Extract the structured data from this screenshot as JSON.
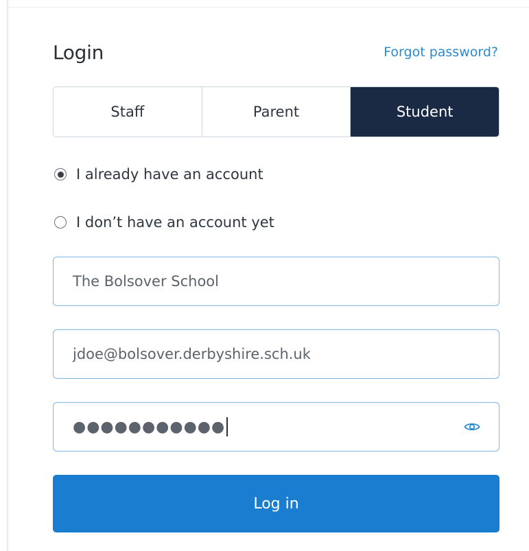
{
  "login": {
    "title": "Login",
    "forgot_password": "Forgot password?"
  },
  "tabs": [
    {
      "label": "Staff",
      "active": false
    },
    {
      "label": "Parent",
      "active": false
    },
    {
      "label": "Student",
      "active": true
    }
  ],
  "account_options": [
    {
      "label": "I already have an account",
      "checked": true
    },
    {
      "label": "I don’t have an account yet",
      "checked": false
    }
  ],
  "fields": {
    "school": "The Bolsover School",
    "email": "jdoe@bolsover.derbyshire.sch.uk",
    "password": "●●●●●●●●●●●"
  },
  "icons": {
    "password_toggle": "eye-icon"
  },
  "colors": {
    "accent": "#1a7dd0",
    "active_tab": "#1b2a44",
    "link": "#2a8ad4",
    "field_border": "#7fb6e3"
  },
  "buttons": {
    "login": "Log in"
  }
}
